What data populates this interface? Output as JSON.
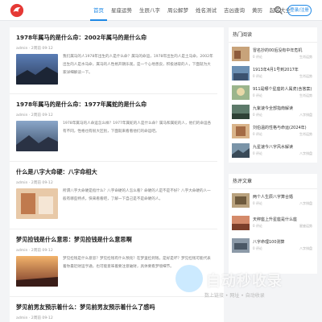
{
  "header": {
    "nav": [
      "首页",
      "星座运势",
      "生辰八字",
      "周公解梦",
      "姓名测试",
      "吉凶查询",
      "黄历",
      "起名大全",
      "风水"
    ],
    "login": "登录/注册"
  },
  "posts": [
    {
      "title": "1978年属马的是什么命：2002年属马的是什么命",
      "author": "admin",
      "time": "2周前",
      "views": "09-12",
      "excerpt": "我们属马的人1978年出生的人是什么命？属马的命运，1978年出生的人是土马命，2002年出生的人是水马命，属马的人性格开朗乐观，是一个心地善良，积极进取的人，下面就为大家详细解读一下。"
    },
    {
      "title": "1978年属马的是什么命：1977年属蛇的是什么命",
      "author": "admin",
      "time": "2周前",
      "views": "09-12",
      "excerpt": "1978年属马的人命运怎么样？1977年属蛇的人是什么命？属马和属蛇的人，他们的命运各有不同，性格也有很大区别，下面就来看看他们的命运吧。"
    },
    {
      "title": "什么是八字大命硬：八字命相大",
      "author": "admin",
      "time": "2周前",
      "views": "09-12",
      "excerpt": "所谓八字大命硬是指什么？八字命硬的人怎么看？命硬的人是不是不好？八字大命硬的人一般有哪些特点，快来看看吧，了解一下自己是不是命硬的人。"
    },
    {
      "title": "梦见捡钱是什么意思：梦见捡钱是什么意思啊",
      "author": "admin",
      "time": "2周前",
      "views": "09-12",
      "excerpt": "梦见捡钱是什么意思？梦见捡钱有什么预兆？在梦里捡到钱，是好是坏？梦见捡钱可能代表着你最近财运亨通，也可能意味着要注意破财，具体要看梦境细节。"
    },
    {
      "title": "梦见前男友预示着什么：梦见前男友预示着什么了感吗",
      "author": "admin",
      "time": "2周前",
      "views": "09-12",
      "excerpt": ""
    }
  ],
  "hot": {
    "title": "热门阅读",
    "items": [
      {
        "title": "冒名抄的00后没有中年危机",
        "sub": "0 评论",
        "cat": "生肖运势"
      },
      {
        "title": "1913年4月1号到2017年",
        "sub": "0 评论",
        "cat": "生肖运势"
      },
      {
        "title": "911是哪个星座的人属虎(含答案)",
        "sub": "0 评论",
        "cat": "生肖运势"
      },
      {
        "title": "九紫速今全部指南解读",
        "sub": "0 评论",
        "cat": "八字排盘"
      },
      {
        "title": "刘伯温的性格与命运(2024年)",
        "sub": "0 评论",
        "cat": "生肖运势"
      },
      {
        "title": "九星速今八字风水解读",
        "sub": "0 评论",
        "cat": "八字排盘"
      }
    ]
  },
  "latest": {
    "title": "热评文章",
    "items": [
      {
        "title": "两个人生辰八字算合婚",
        "sub": "0 评论",
        "cat": "八字排盘"
      },
      {
        "title": "天秤座上升星座是什么座",
        "sub": "0 评论",
        "cat": "星座运势"
      },
      {
        "title": "八字命理100测算",
        "sub": "0 评论",
        "cat": "八字排盘"
      }
    ]
  },
  "watermark": {
    "text": "自动秒收录",
    "sub": "数上链接 • 网址 • 自动收录"
  }
}
